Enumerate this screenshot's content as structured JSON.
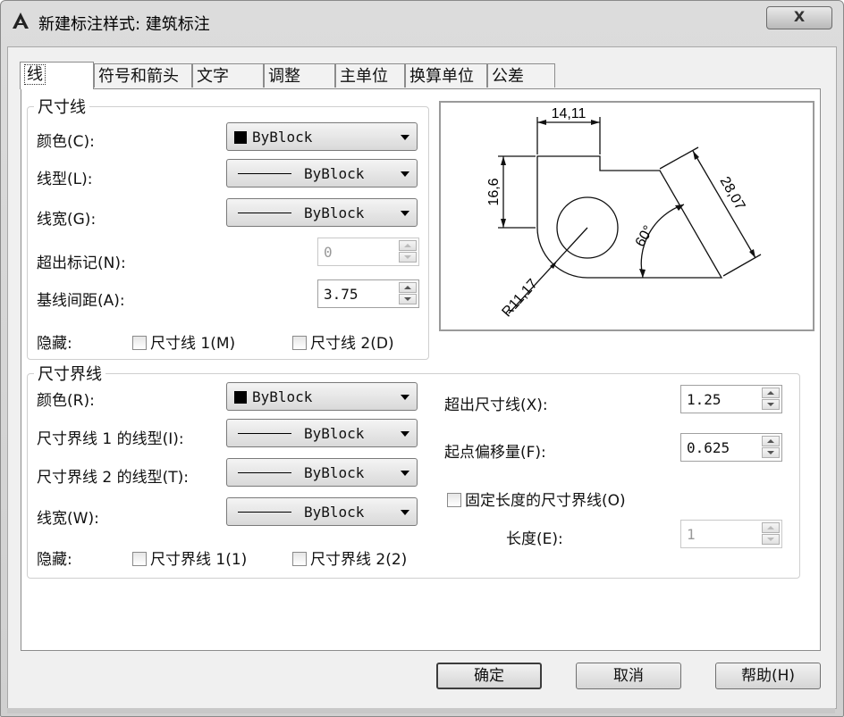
{
  "window": {
    "title": "新建标注样式: 建筑标注",
    "close_label": "X"
  },
  "tabs": [
    "线",
    "符号和箭头",
    "文字",
    "调整",
    "主单位",
    "换算单位",
    "公差"
  ],
  "dim_line": {
    "group_title": "尺寸线",
    "color_label": "颜色(C):",
    "color_value": "ByBlock",
    "linetype_label": "线型(L):",
    "linetype_value": "ByBlock",
    "lineweight_label": "线宽(G):",
    "lineweight_value": "ByBlock",
    "extend_ticks_label": "超出标记(N):",
    "extend_ticks_value": "0",
    "baseline_spacing_label": "基线间距(A):",
    "baseline_spacing_value": "3.75",
    "suppress_label": "隐藏:",
    "suppress_1": "尺寸线 1(M)",
    "suppress_2": "尺寸线 2(D)"
  },
  "ext_line": {
    "group_title": "尺寸界线",
    "color_label": "颜色(R):",
    "color_value": "ByBlock",
    "linetype1_label": "尺寸界线 1 的线型(I):",
    "linetype1_value": "ByBlock",
    "linetype2_label": "尺寸界线 2 的线型(T):",
    "linetype2_value": "ByBlock",
    "lineweight_label": "线宽(W):",
    "lineweight_value": "ByBlock",
    "suppress_label": "隐藏:",
    "suppress_1": "尺寸界线 1(1)",
    "suppress_2": "尺寸界线 2(2)",
    "extend_label": "超出尺寸线(X):",
    "extend_value": "1.25",
    "offset_label": "起点偏移量(F):",
    "offset_value": "0.625",
    "fixed_length_label": "固定长度的尺寸界线(O)",
    "length_label": "长度(E):",
    "length_value": "1"
  },
  "preview": {
    "dim_top": "14,11",
    "dim_left": "16,6",
    "dim_slant": "28,07",
    "dim_angle": "60°",
    "dim_radius": "R11,17"
  },
  "buttons": {
    "ok": "确定",
    "cancel": "取消",
    "help": "帮助(H)"
  }
}
